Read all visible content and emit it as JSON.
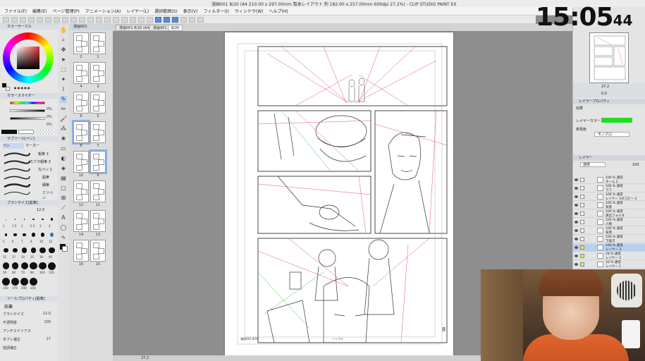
{
  "app": {
    "window_title": "漫画001 8/20 (A4 210.00 x 297.00mm  製本レイアウト 判 182.00 x 257.00mm 600dpi 27.2%) - CLIP STUDIO PAINT EX",
    "menu": [
      "ファイル(F)",
      "編集(E)",
      "ページ管理(P)",
      "アニメーション(A)",
      "レイヤー(L)",
      "選択範囲(S)",
      "表示(V)",
      "フィルター(I)",
      "ウィンドウ(W)",
      "ヘルプ(H)"
    ]
  },
  "clock": {
    "hm": "15:05",
    "sec": "44"
  },
  "left_panel": {
    "color_wheel_title": "カラーサークル",
    "color_slider_title": "カラースライダー",
    "slider_values": [
      "0%",
      "0%",
      "0%"
    ],
    "subtool_title": "サブツール[ペン]",
    "subtool_tabs": [
      "ペン",
      "マーカー"
    ],
    "brushes": [
      "粗筆 3",
      "カブラ粗筆 3",
      "丸ペン 2",
      "鉛筆",
      "細筆",
      "ミリペン"
    ],
    "brush_size_title": "ブラシサイズ[鉛筆]",
    "brush_size_value": "12.0",
    "brush_sizes": [
      "1",
      "1.5",
      "2",
      "2.5",
      "3",
      "4",
      "5",
      "6",
      "7",
      "8",
      "10",
      "12",
      "15",
      "17",
      "20",
      "25",
      "30",
      "40",
      "50",
      "60",
      "70",
      "80",
      "100",
      "120",
      "150",
      "170",
      "200",
      "250"
    ],
    "tool_property_title": "ツールプロパティ[鉛筆]",
    "tool_property_label": "鉛筆",
    "props": [
      {
        "label": "ブラシサイズ",
        "value": "12.0"
      },
      {
        "label": "不透明度",
        "value": "100"
      },
      {
        "label": "アンチエイリアス",
        "value": ""
      },
      {
        "label": "手ブレ補正",
        "value": "17"
      },
      {
        "label": "強調補正",
        "value": ""
      }
    ],
    "colors": {
      "main": "#111111",
      "sub": "#ffffff"
    }
  },
  "page_nav": {
    "tab": "漫画001",
    "pages": [
      {
        "label": "1"
      },
      {
        "label": "2"
      },
      {
        "label": "3"
      },
      {
        "label": "4"
      },
      {
        "label": "5"
      },
      {
        "label": "6"
      },
      {
        "label": "7"
      },
      {
        "label": "8"
      },
      {
        "label": "9"
      },
      {
        "label": "10"
      },
      {
        "label": "11"
      },
      {
        "label": "12"
      },
      {
        "label": "13"
      },
      {
        "label": "14"
      },
      {
        "label": "15"
      },
      {
        "label": "16"
      }
    ]
  },
  "canvas": {
    "tabs": [
      "漫画001 8/20 (A4 21...",
      "漫画001",
      "8/20"
    ],
    "page_number": "8",
    "footer_left": "漫画001 8/20",
    "footer_center": "ノンブル",
    "zoom": "27.2"
  },
  "right_panel": {
    "nav_zoom": "27.2",
    "nav_angle": "0.0",
    "layer_property_title": "レイヤープロパティ",
    "effect_label": "効果",
    "layer_color_label": "レイヤーカラー",
    "layer_color": "#22dd22",
    "expression_label": "表現色",
    "expression_value": "モノクロ",
    "layer_panel_title": "レイヤー",
    "blend_mode": "通常",
    "opacity": "100",
    "layers": [
      {
        "name": "100 % 通常",
        "sub": "ネーム 2",
        "selected": false
      },
      {
        "name": "100 % 通常",
        "sub": "ラフ",
        "selected": false
      },
      {
        "name": "100 % 通常",
        "sub": "レイヤー 1のコピー 2",
        "selected": false
      },
      {
        "name": "100 % 通常",
        "sub": "背景",
        "selected": false
      },
      {
        "name": "100 % 通常",
        "sub": "演出フォルダ",
        "selected": false
      },
      {
        "name": "100 % 通常",
        "sub": "人物",
        "selected": false
      },
      {
        "name": "100 % 通常",
        "sub": "背景",
        "selected": false
      },
      {
        "name": "100 % 通常",
        "sub": "下描き",
        "selected": false
      },
      {
        "name": "100 % 通常",
        "sub": "レイヤー 3",
        "selected": true
      },
      {
        "name": "28 % 通常",
        "sub": "レイヤー 2",
        "selected": false
      },
      {
        "name": "10 % 通常",
        "sub": "レイヤー 1",
        "selected": false
      }
    ]
  }
}
